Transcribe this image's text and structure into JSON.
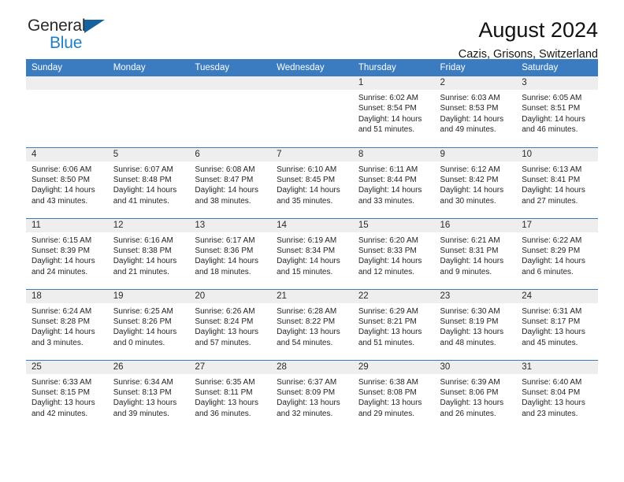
{
  "brand": {
    "name_part1": "General",
    "name_part2": "Blue",
    "triangle_color": "#15629f",
    "blue_color": "#1f7fc4"
  },
  "header": {
    "title": "August 2024",
    "subtitle": "Cazis, Grisons, Switzerland"
  },
  "theme": {
    "header_band": "#3a7cbf",
    "daynum_strip": "#eeeeee",
    "text": "#242424"
  },
  "weekday_headers": [
    "Sunday",
    "Monday",
    "Tuesday",
    "Wednesday",
    "Thursday",
    "Friday",
    "Saturday"
  ],
  "weeks": [
    [
      {
        "day": "",
        "lines": [
          "",
          "",
          "",
          ""
        ]
      },
      {
        "day": "",
        "lines": [
          "",
          "",
          "",
          ""
        ]
      },
      {
        "day": "",
        "lines": [
          "",
          "",
          "",
          ""
        ]
      },
      {
        "day": "",
        "lines": [
          "",
          "",
          "",
          ""
        ]
      },
      {
        "day": "1",
        "lines": [
          "Sunrise: 6:02 AM",
          "Sunset: 8:54 PM",
          "Daylight: 14 hours",
          "and 51 minutes."
        ]
      },
      {
        "day": "2",
        "lines": [
          "Sunrise: 6:03 AM",
          "Sunset: 8:53 PM",
          "Daylight: 14 hours",
          "and 49 minutes."
        ]
      },
      {
        "day": "3",
        "lines": [
          "Sunrise: 6:05 AM",
          "Sunset: 8:51 PM",
          "Daylight: 14 hours",
          "and 46 minutes."
        ]
      }
    ],
    [
      {
        "day": "4",
        "lines": [
          "Sunrise: 6:06 AM",
          "Sunset: 8:50 PM",
          "Daylight: 14 hours",
          "and 43 minutes."
        ]
      },
      {
        "day": "5",
        "lines": [
          "Sunrise: 6:07 AM",
          "Sunset: 8:48 PM",
          "Daylight: 14 hours",
          "and 41 minutes."
        ]
      },
      {
        "day": "6",
        "lines": [
          "Sunrise: 6:08 AM",
          "Sunset: 8:47 PM",
          "Daylight: 14 hours",
          "and 38 minutes."
        ]
      },
      {
        "day": "7",
        "lines": [
          "Sunrise: 6:10 AM",
          "Sunset: 8:45 PM",
          "Daylight: 14 hours",
          "and 35 minutes."
        ]
      },
      {
        "day": "8",
        "lines": [
          "Sunrise: 6:11 AM",
          "Sunset: 8:44 PM",
          "Daylight: 14 hours",
          "and 33 minutes."
        ]
      },
      {
        "day": "9",
        "lines": [
          "Sunrise: 6:12 AM",
          "Sunset: 8:42 PM",
          "Daylight: 14 hours",
          "and 30 minutes."
        ]
      },
      {
        "day": "10",
        "lines": [
          "Sunrise: 6:13 AM",
          "Sunset: 8:41 PM",
          "Daylight: 14 hours",
          "and 27 minutes."
        ]
      }
    ],
    [
      {
        "day": "11",
        "lines": [
          "Sunrise: 6:15 AM",
          "Sunset: 8:39 PM",
          "Daylight: 14 hours",
          "and 24 minutes."
        ]
      },
      {
        "day": "12",
        "lines": [
          "Sunrise: 6:16 AM",
          "Sunset: 8:38 PM",
          "Daylight: 14 hours",
          "and 21 minutes."
        ]
      },
      {
        "day": "13",
        "lines": [
          "Sunrise: 6:17 AM",
          "Sunset: 8:36 PM",
          "Daylight: 14 hours",
          "and 18 minutes."
        ]
      },
      {
        "day": "14",
        "lines": [
          "Sunrise: 6:19 AM",
          "Sunset: 8:34 PM",
          "Daylight: 14 hours",
          "and 15 minutes."
        ]
      },
      {
        "day": "15",
        "lines": [
          "Sunrise: 6:20 AM",
          "Sunset: 8:33 PM",
          "Daylight: 14 hours",
          "and 12 minutes."
        ]
      },
      {
        "day": "16",
        "lines": [
          "Sunrise: 6:21 AM",
          "Sunset: 8:31 PM",
          "Daylight: 14 hours",
          "and 9 minutes."
        ]
      },
      {
        "day": "17",
        "lines": [
          "Sunrise: 6:22 AM",
          "Sunset: 8:29 PM",
          "Daylight: 14 hours",
          "and 6 minutes."
        ]
      }
    ],
    [
      {
        "day": "18",
        "lines": [
          "Sunrise: 6:24 AM",
          "Sunset: 8:28 PM",
          "Daylight: 14 hours",
          "and 3 minutes."
        ]
      },
      {
        "day": "19",
        "lines": [
          "Sunrise: 6:25 AM",
          "Sunset: 8:26 PM",
          "Daylight: 14 hours",
          "and 0 minutes."
        ]
      },
      {
        "day": "20",
        "lines": [
          "Sunrise: 6:26 AM",
          "Sunset: 8:24 PM",
          "Daylight: 13 hours",
          "and 57 minutes."
        ]
      },
      {
        "day": "21",
        "lines": [
          "Sunrise: 6:28 AM",
          "Sunset: 8:22 PM",
          "Daylight: 13 hours",
          "and 54 minutes."
        ]
      },
      {
        "day": "22",
        "lines": [
          "Sunrise: 6:29 AM",
          "Sunset: 8:21 PM",
          "Daylight: 13 hours",
          "and 51 minutes."
        ]
      },
      {
        "day": "23",
        "lines": [
          "Sunrise: 6:30 AM",
          "Sunset: 8:19 PM",
          "Daylight: 13 hours",
          "and 48 minutes."
        ]
      },
      {
        "day": "24",
        "lines": [
          "Sunrise: 6:31 AM",
          "Sunset: 8:17 PM",
          "Daylight: 13 hours",
          "and 45 minutes."
        ]
      }
    ],
    [
      {
        "day": "25",
        "lines": [
          "Sunrise: 6:33 AM",
          "Sunset: 8:15 PM",
          "Daylight: 13 hours",
          "and 42 minutes."
        ]
      },
      {
        "day": "26",
        "lines": [
          "Sunrise: 6:34 AM",
          "Sunset: 8:13 PM",
          "Daylight: 13 hours",
          "and 39 minutes."
        ]
      },
      {
        "day": "27",
        "lines": [
          "Sunrise: 6:35 AM",
          "Sunset: 8:11 PM",
          "Daylight: 13 hours",
          "and 36 minutes."
        ]
      },
      {
        "day": "28",
        "lines": [
          "Sunrise: 6:37 AM",
          "Sunset: 8:09 PM",
          "Daylight: 13 hours",
          "and 32 minutes."
        ]
      },
      {
        "day": "29",
        "lines": [
          "Sunrise: 6:38 AM",
          "Sunset: 8:08 PM",
          "Daylight: 13 hours",
          "and 29 minutes."
        ]
      },
      {
        "day": "30",
        "lines": [
          "Sunrise: 6:39 AM",
          "Sunset: 8:06 PM",
          "Daylight: 13 hours",
          "and 26 minutes."
        ]
      },
      {
        "day": "31",
        "lines": [
          "Sunrise: 6:40 AM",
          "Sunset: 8:04 PM",
          "Daylight: 13 hours",
          "and 23 minutes."
        ]
      }
    ]
  ]
}
